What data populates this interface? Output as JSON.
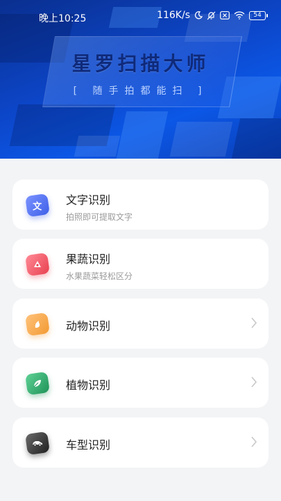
{
  "status_bar": {
    "time": "晚上10:25",
    "speed": "116K/s",
    "battery": "54"
  },
  "header": {
    "title": "星罗扫描大师",
    "slogan": "[ 随手拍都能扫 ]"
  },
  "features": [
    {
      "title": "文字识别",
      "subtitle": "拍照即可提取文字",
      "icon": "text-recognition-icon",
      "glyph": "文",
      "color": "#4f6ef2"
    },
    {
      "title": "果蔬识别",
      "subtitle": "水果蔬菜轻松区分",
      "icon": "fruit-icon",
      "color": "#f0596b"
    },
    {
      "title": "动物识别",
      "subtitle": "",
      "icon": "animal-icon",
      "color": "#f6a546"
    },
    {
      "title": "植物识别",
      "subtitle": "",
      "icon": "plant-icon",
      "color": "#2fa86c"
    },
    {
      "title": "车型识别",
      "subtitle": "",
      "icon": "car-icon",
      "color": "#3a3a3a"
    }
  ]
}
